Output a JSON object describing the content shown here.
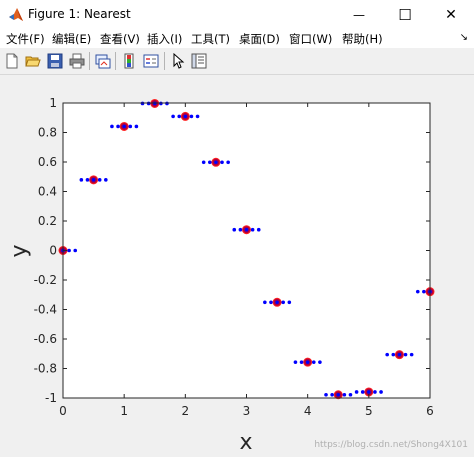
{
  "window": {
    "title": "Figure 1: Nearest",
    "minimize_symbol": "—",
    "maximize_symbol": "☐",
    "close_symbol": "✕"
  },
  "menu": [
    {
      "id": "file",
      "label": "文件(F)"
    },
    {
      "id": "edit",
      "label": "编辑(E)"
    },
    {
      "id": "view",
      "label": "查看(V)"
    },
    {
      "id": "insert",
      "label": "插入(I)"
    },
    {
      "id": "tools",
      "label": "工具(T)"
    },
    {
      "id": "desktop",
      "label": "桌面(D)"
    },
    {
      "id": "window",
      "label": "窗口(W)"
    },
    {
      "id": "help",
      "label": "帮助(H)"
    }
  ],
  "toolbar": {
    "icons": [
      "new-figure-icon",
      "open-file-icon",
      "save-icon",
      "print-icon",
      "link-plot-icon",
      "colorbar-icon",
      "legend-icon",
      "pointer-icon",
      "property-inspector-icon"
    ]
  },
  "watermark": "https://blog.csdn.net/Shong4X101",
  "chart_data": {
    "type": "scatter",
    "title": "",
    "xlabel": "x",
    "ylabel": "y",
    "xlim": [
      0,
      6
    ],
    "ylim": [
      -1,
      1
    ],
    "xticks": [
      "0",
      "1",
      "2",
      "3",
      "4",
      "5",
      "6"
    ],
    "yticks": [
      "-1",
      "-0.8",
      "-0.6",
      "-0.4",
      "-0.2",
      "0",
      "0.2",
      "0.4",
      "0.6",
      "0.8",
      "1"
    ],
    "grid": false,
    "colors": {
      "samples": "#b2003c",
      "sample_edge": "#ff2020",
      "interp": "#0000ff"
    },
    "series": [
      {
        "marker": "circle",
        "x": [
          0,
          0.5,
          1,
          1.5,
          2,
          2.5,
          3,
          3.5,
          4,
          4.5,
          5,
          5.5,
          6
        ],
        "y": [
          0,
          0.479,
          0.841,
          0.997,
          0.909,
          0.598,
          0.141,
          -0.351,
          -0.757,
          -0.978,
          -0.959,
          -0.706,
          -0.279
        ]
      },
      {
        "marker": "dot",
        "x": [
          0,
          0.1,
          0.2,
          0.3,
          0.4,
          0.5,
          0.6,
          0.7,
          0.8,
          0.9,
          1,
          1.1,
          1.2,
          1.3,
          1.4,
          1.5,
          1.6,
          1.7,
          1.8,
          1.9,
          2,
          2.1,
          2.2,
          2.3,
          2.4,
          2.5,
          2.6,
          2.7,
          2.8,
          2.9,
          3,
          3.1,
          3.2,
          3.3,
          3.4,
          3.5,
          3.6,
          3.7,
          3.8,
          3.9,
          4,
          4.1,
          4.2,
          4.3,
          4.4,
          4.5,
          4.6,
          4.7,
          4.8,
          4.9,
          5,
          5.1,
          5.2,
          5.3,
          5.4,
          5.5,
          5.6,
          5.7,
          5.8,
          5.9,
          6
        ],
        "y": [
          0,
          0,
          0,
          0.479,
          0.479,
          0.479,
          0.479,
          0.479,
          0.841,
          0.841,
          0.841,
          0.841,
          0.841,
          0.997,
          0.997,
          0.997,
          0.997,
          0.997,
          0.909,
          0.909,
          0.909,
          0.909,
          0.909,
          0.598,
          0.598,
          0.598,
          0.598,
          0.598,
          0.141,
          0.141,
          0.141,
          0.141,
          0.141,
          -0.351,
          -0.351,
          -0.351,
          -0.351,
          -0.351,
          -0.757,
          -0.757,
          -0.757,
          -0.757,
          -0.757,
          -0.978,
          -0.978,
          -0.978,
          -0.978,
          -0.978,
          -0.959,
          -0.959,
          -0.959,
          -0.959,
          -0.959,
          -0.706,
          -0.706,
          -0.706,
          -0.706,
          -0.706,
          -0.279,
          -0.279,
          -0.279
        ]
      }
    ]
  }
}
